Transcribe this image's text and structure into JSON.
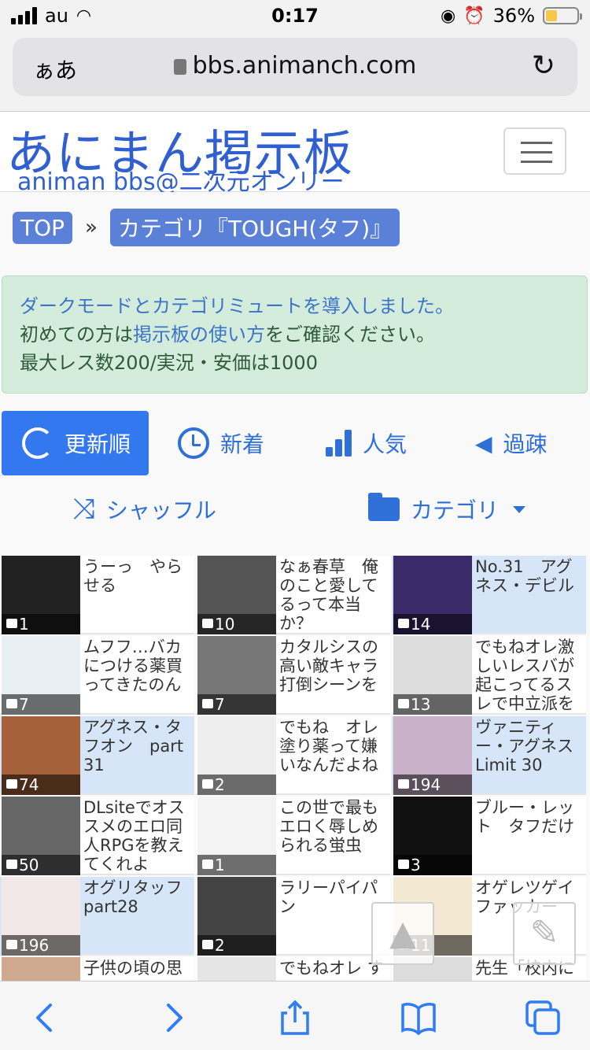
{
  "status_bar": {
    "carrier": "au",
    "time": "0:17",
    "battery_percent": "36%",
    "battery_level": 0.36
  },
  "browser": {
    "aa_label": "ぁあ",
    "url": "bbs.animanch.com"
  },
  "site": {
    "logo_title": "あにまん掲示板",
    "logo_subtitle": "animan bbs@二次元オンリー"
  },
  "breadcrumb": {
    "top": "TOP",
    "separator": "»",
    "category": "カテゴリ『TOUGH(タフ)』"
  },
  "notice": {
    "line1_link": "ダークモードとカテゴリミュートを導入しました。",
    "line2_prefix": "初めての方は",
    "line2_link": "掲示板の使い方",
    "line2_suffix": "をご確認ください。",
    "line3": "最大レス数200/実況・安価は1000"
  },
  "sort_tabs": {
    "update": "更新順",
    "new": "新着",
    "popular": "人気",
    "sparse": "過疎",
    "shuffle": "シャッフル",
    "category": "カテゴリ"
  },
  "threads": [
    {
      "title": "うーっ　やらせる",
      "count": "1",
      "highlight": false
    },
    {
      "title": "なぁ春草　俺のこと愛してるって本当か？",
      "count": "10",
      "highlight": false
    },
    {
      "title": "No.31　アグネス・デビル",
      "count": "14",
      "highlight": true
    },
    {
      "title": "ムフフ…バカにつける薬買ってきたのん",
      "count": "7",
      "highlight": false
    },
    {
      "title": "カタルシスの高い敵キャラ打倒シーンを",
      "count": "7",
      "highlight": false
    },
    {
      "title": "でもねオレ激しいレスバが起こってるスレで中立派を",
      "count": "13",
      "highlight": false
    },
    {
      "title": "アグネス・タフオン　part 31",
      "count": "74",
      "highlight": true
    },
    {
      "title": "でもね　オレ塗り薬って嫌いなんだよね",
      "count": "2",
      "highlight": false
    },
    {
      "title": "ヴァニティー・アグネス Limit 30",
      "count": "194",
      "highlight": true
    },
    {
      "title": "DLsiteでオススメのエロ同人RPGを教えてくれよ",
      "count": "50",
      "highlight": false
    },
    {
      "title": "この世で最もエロく辱しめられる蛍虫",
      "count": "1",
      "highlight": false
    },
    {
      "title": "ブルー・レット　タフだけ",
      "count": "3",
      "highlight": false
    },
    {
      "title": "オグリタッフ part28",
      "count": "196",
      "highlight": true
    },
    {
      "title": "ラリーパイパン",
      "count": "2",
      "highlight": false
    },
    {
      "title": "オゲレツゲイファッカー",
      "count": "11",
      "highlight": false
    },
    {
      "title": "子供の頃の思",
      "count": "",
      "highlight": false
    },
    {
      "title": "でもねオレ す",
      "count": "",
      "highlight": false
    },
    {
      "title": "先生「校内に",
      "count": "",
      "highlight": false
    }
  ],
  "colors": {
    "brand_blue": "#2f5fd0",
    "active_tab": "#3478f0",
    "notice_bg": "#d4ecdb",
    "highlight_cell": "#d6e6f8"
  }
}
